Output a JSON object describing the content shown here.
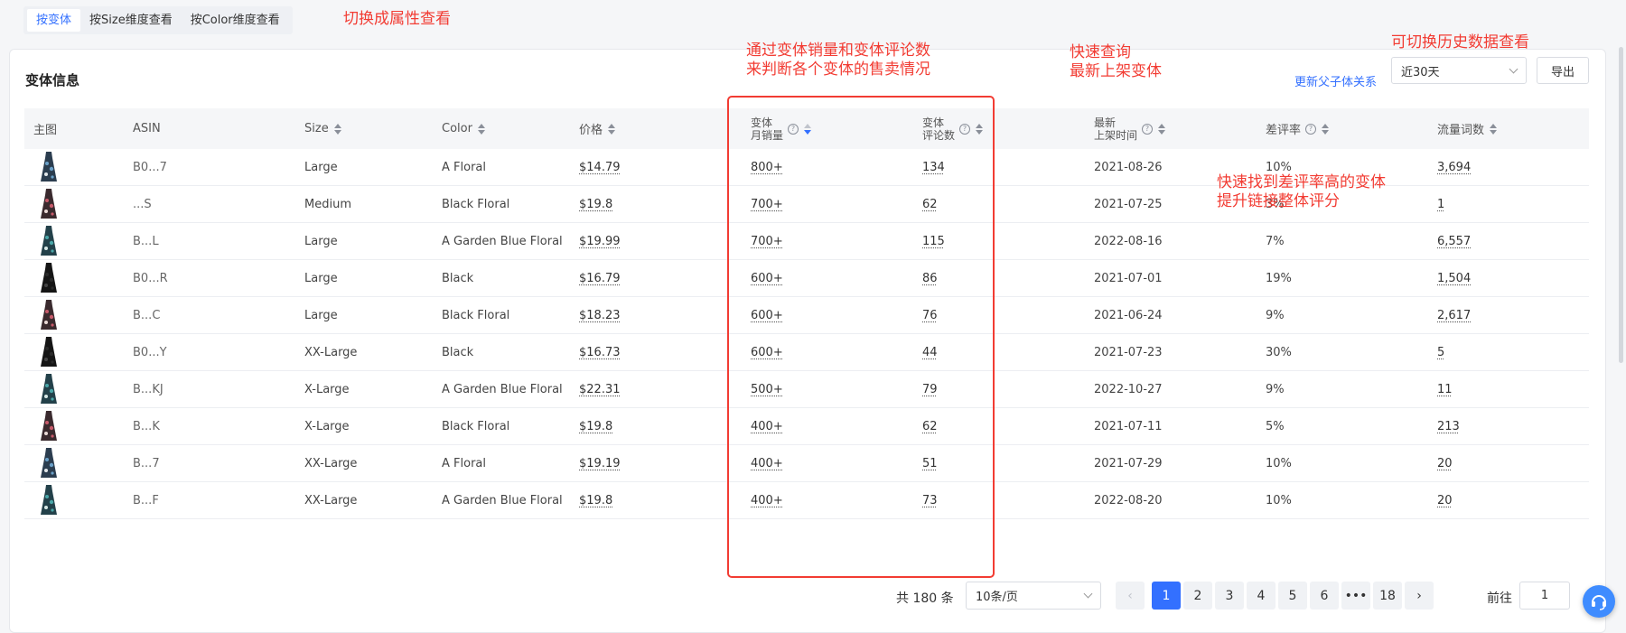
{
  "tabs": [
    {
      "label": "按变体",
      "active": true
    },
    {
      "label": "按Size维度查看",
      "active": false
    },
    {
      "label": "按Color维度查看",
      "active": false
    }
  ],
  "annotations": {
    "switch_attr": "切换成属性查看",
    "sales_reviews": "通过变体销量和变体评论数\n来判断各个变体的售卖情况",
    "quick_query": "快速查询\n最新上架变体",
    "history": "可切换历史数据查看",
    "bad_rate": "快速找到差评率高的变体\n提升链接整体评分"
  },
  "card": {
    "title": "变体信息",
    "parent_child_link": "更新父子体关系",
    "period": "近30天",
    "export": "导出"
  },
  "columns": {
    "image": "主图",
    "asin": "ASIN",
    "size": "Size",
    "color": "Color",
    "price": "价格",
    "monthly_sales": "变体\n月销量",
    "reviews": "变体\n评论数",
    "listed": "最新\n上架时间",
    "bad_rate": "差评率",
    "traffic": "流量词数"
  },
  "rows": [
    {
      "asin": "B0...7",
      "size": "Large",
      "color": "A Floral",
      "price": "$14.79",
      "sales": "800+",
      "reviews": "134",
      "date": "2021-08-26",
      "bad": "10%",
      "traffic": "3,694",
      "dress": "floral-blue"
    },
    {
      "asin": "...S",
      "size": "Medium",
      "color": "Black Floral",
      "price": "$19.8",
      "sales": "700+",
      "reviews": "62",
      "date": "2021-07-25",
      "bad": "3%",
      "traffic": "1",
      "dress": "floral-red"
    },
    {
      "asin": "B...L",
      "size": "Large",
      "color": "A Garden Blue Floral",
      "price": "$19.99",
      "sales": "700+",
      "reviews": "115",
      "date": "2022-08-16",
      "bad": "7%",
      "traffic": "6,557",
      "dress": "floral-teal"
    },
    {
      "asin": "B0...R",
      "size": "Large",
      "color": "Black",
      "price": "$16.79",
      "sales": "600+",
      "reviews": "86",
      "date": "2021-07-01",
      "bad": "19%",
      "traffic": "1,504",
      "dress": "black"
    },
    {
      "asin": "B...C",
      "size": "Large",
      "color": "Black Floral",
      "price": "$18.23",
      "sales": "600+",
      "reviews": "76",
      "date": "2021-06-24",
      "bad": "9%",
      "traffic": "2,617",
      "dress": "floral-red"
    },
    {
      "asin": "B0...Y",
      "size": "XX-Large",
      "color": "Black",
      "price": "$16.73",
      "sales": "600+",
      "reviews": "44",
      "date": "2021-07-23",
      "bad": "30%",
      "traffic": "5",
      "dress": "black"
    },
    {
      "asin": "B...KJ",
      "size": "X-Large",
      "color": "A Garden Blue Floral",
      "price": "$22.31",
      "sales": "500+",
      "reviews": "79",
      "date": "2022-10-27",
      "bad": "9%",
      "traffic": "11",
      "dress": "floral-teal"
    },
    {
      "asin": "B...K",
      "size": "X-Large",
      "color": "Black Floral",
      "price": "$19.8",
      "sales": "400+",
      "reviews": "62",
      "date": "2021-07-11",
      "bad": "5%",
      "traffic": "213",
      "dress": "floral-red"
    },
    {
      "asin": "B...7",
      "size": "XX-Large",
      "color": "A Floral",
      "price": "$19.19",
      "sales": "400+",
      "reviews": "51",
      "date": "2021-07-29",
      "bad": "10%",
      "traffic": "20",
      "dress": "floral-blue"
    },
    {
      "asin": "B...F",
      "size": "XX-Large",
      "color": "A Garden Blue Floral",
      "price": "$19.8",
      "sales": "400+",
      "reviews": "73",
      "date": "2022-08-20",
      "bad": "10%",
      "traffic": "20",
      "dress": "floral-teal"
    }
  ],
  "pagination": {
    "total": "共 180 条",
    "page_size": "10条/页",
    "pages": [
      "1",
      "2",
      "3",
      "4",
      "5",
      "6",
      "•••",
      "18"
    ],
    "current": "1",
    "goto_label": "前往",
    "goto_value": "1"
  },
  "colors": {
    "accent": "#3370ff",
    "annotation": "#f23c33"
  }
}
